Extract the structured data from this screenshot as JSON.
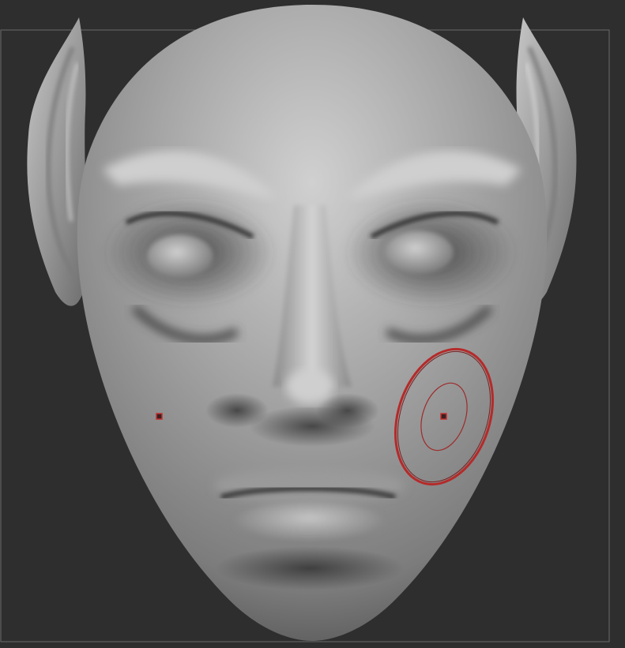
{
  "viewport": {
    "background_color": "#2e2e2e",
    "frame_color": "#6a6a6a",
    "model": {
      "kind": "sculpted-head-front-view",
      "material_color": "#9e9e9e",
      "highlight_color": "#d6d6d6",
      "shadow_color": "#3a3a3a"
    },
    "brush_cursor": {
      "icon": "brush-cursor-icon",
      "color": "#b52a2a"
    },
    "symmetry_marker": {
      "icon": "symmetry-point-icon",
      "color": "#b52a2a"
    }
  }
}
